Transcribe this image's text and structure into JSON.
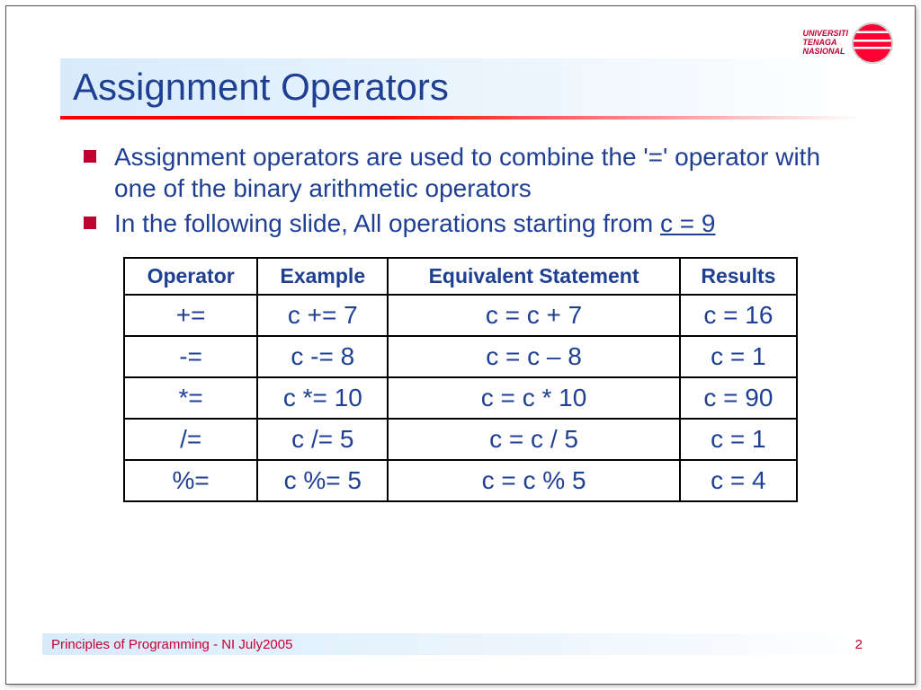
{
  "logo": {
    "line1": "UNIVERSITI",
    "line2": "TENAGA",
    "line3": "NASIONAL"
  },
  "title": "Assignment Operators",
  "bullets": [
    {
      "text": "Assignment operators are used to combine the '=' operator with one of the binary arithmetic operators"
    },
    {
      "text_prefix": "In the following slide, All operations starting from ",
      "underlined": "c = 9"
    }
  ],
  "table": {
    "headers": [
      "Operator",
      "Example",
      "Equivalent Statement",
      "Results"
    ],
    "rows": [
      {
        "op": "+=",
        "ex": "c += 7",
        "eq": "c = c + 7",
        "res": "c = 16"
      },
      {
        "op": "-=",
        "ex": "c -= 8",
        "eq": "c = c – 8",
        "res": "c = 1"
      },
      {
        "op": "*=",
        "ex": "c *= 10",
        "eq": "c = c * 10",
        "res": "c = 90"
      },
      {
        "op": "/=",
        "ex": "c /= 5",
        "eq": "c = c / 5",
        "res": "c = 1"
      },
      {
        "op": "%=",
        "ex": "c %= 5",
        "eq": "c = c % 5",
        "res": "c = 4"
      }
    ]
  },
  "footer": {
    "left": "Principles of Programming - NI July2005",
    "page": "2"
  }
}
